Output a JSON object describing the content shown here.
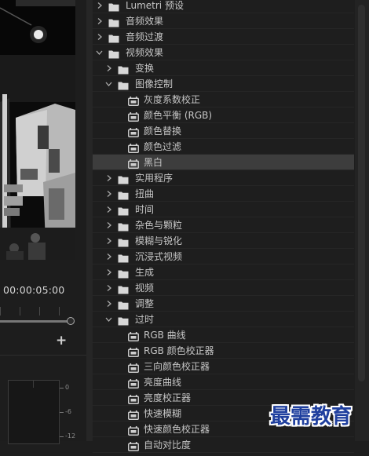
{
  "monitor": {
    "timecode": "00:00:05:00",
    "add_button": "+",
    "meter_labels": [
      "0",
      "-6",
      "-12"
    ]
  },
  "effects_tree": [
    {
      "indent": 0,
      "type": "folder",
      "expanded": false,
      "label": "Lumetri 预设"
    },
    {
      "indent": 0,
      "type": "folder",
      "expanded": false,
      "label": "音频效果"
    },
    {
      "indent": 0,
      "type": "folder",
      "expanded": false,
      "label": "音频过渡"
    },
    {
      "indent": 0,
      "type": "folder",
      "expanded": true,
      "label": "视频效果"
    },
    {
      "indent": 1,
      "type": "folder",
      "expanded": false,
      "label": "变换"
    },
    {
      "indent": 1,
      "type": "folder",
      "expanded": true,
      "label": "图像控制"
    },
    {
      "indent": 2,
      "type": "effect",
      "label": "灰度系数校正"
    },
    {
      "indent": 2,
      "type": "effect",
      "label": "颜色平衡 (RGB)"
    },
    {
      "indent": 2,
      "type": "effect",
      "label": "颜色替换"
    },
    {
      "indent": 2,
      "type": "effect",
      "label": "颜色过滤"
    },
    {
      "indent": 2,
      "type": "effect",
      "label": "黑白",
      "selected": true
    },
    {
      "indent": 1,
      "type": "folder",
      "expanded": false,
      "label": "实用程序"
    },
    {
      "indent": 1,
      "type": "folder",
      "expanded": false,
      "label": "扭曲"
    },
    {
      "indent": 1,
      "type": "folder",
      "expanded": false,
      "label": "时间"
    },
    {
      "indent": 1,
      "type": "folder",
      "expanded": false,
      "label": "杂色与颗粒"
    },
    {
      "indent": 1,
      "type": "folder",
      "expanded": false,
      "label": "模糊与锐化"
    },
    {
      "indent": 1,
      "type": "folder",
      "expanded": false,
      "label": "沉浸式视频"
    },
    {
      "indent": 1,
      "type": "folder",
      "expanded": false,
      "label": "生成"
    },
    {
      "indent": 1,
      "type": "folder",
      "expanded": false,
      "label": "视频"
    },
    {
      "indent": 1,
      "type": "folder",
      "expanded": false,
      "label": "调整"
    },
    {
      "indent": 1,
      "type": "folder",
      "expanded": true,
      "label": "过时"
    },
    {
      "indent": 2,
      "type": "effect",
      "label": "RGB 曲线"
    },
    {
      "indent": 2,
      "type": "effect",
      "label": "RGB 颜色校正器"
    },
    {
      "indent": 2,
      "type": "effect",
      "label": "三向颜色校正器"
    },
    {
      "indent": 2,
      "type": "effect",
      "label": "亮度曲线"
    },
    {
      "indent": 2,
      "type": "effect",
      "label": "亮度校正器"
    },
    {
      "indent": 2,
      "type": "effect",
      "label": "快速模糊"
    },
    {
      "indent": 2,
      "type": "effect",
      "label": "快速颜色校正器"
    },
    {
      "indent": 2,
      "type": "effect",
      "label": "自动对比度"
    }
  ],
  "watermark": "最需教育",
  "colors": {
    "selected_row": "#3d3d3d",
    "watermark": "#1f3f9e"
  }
}
